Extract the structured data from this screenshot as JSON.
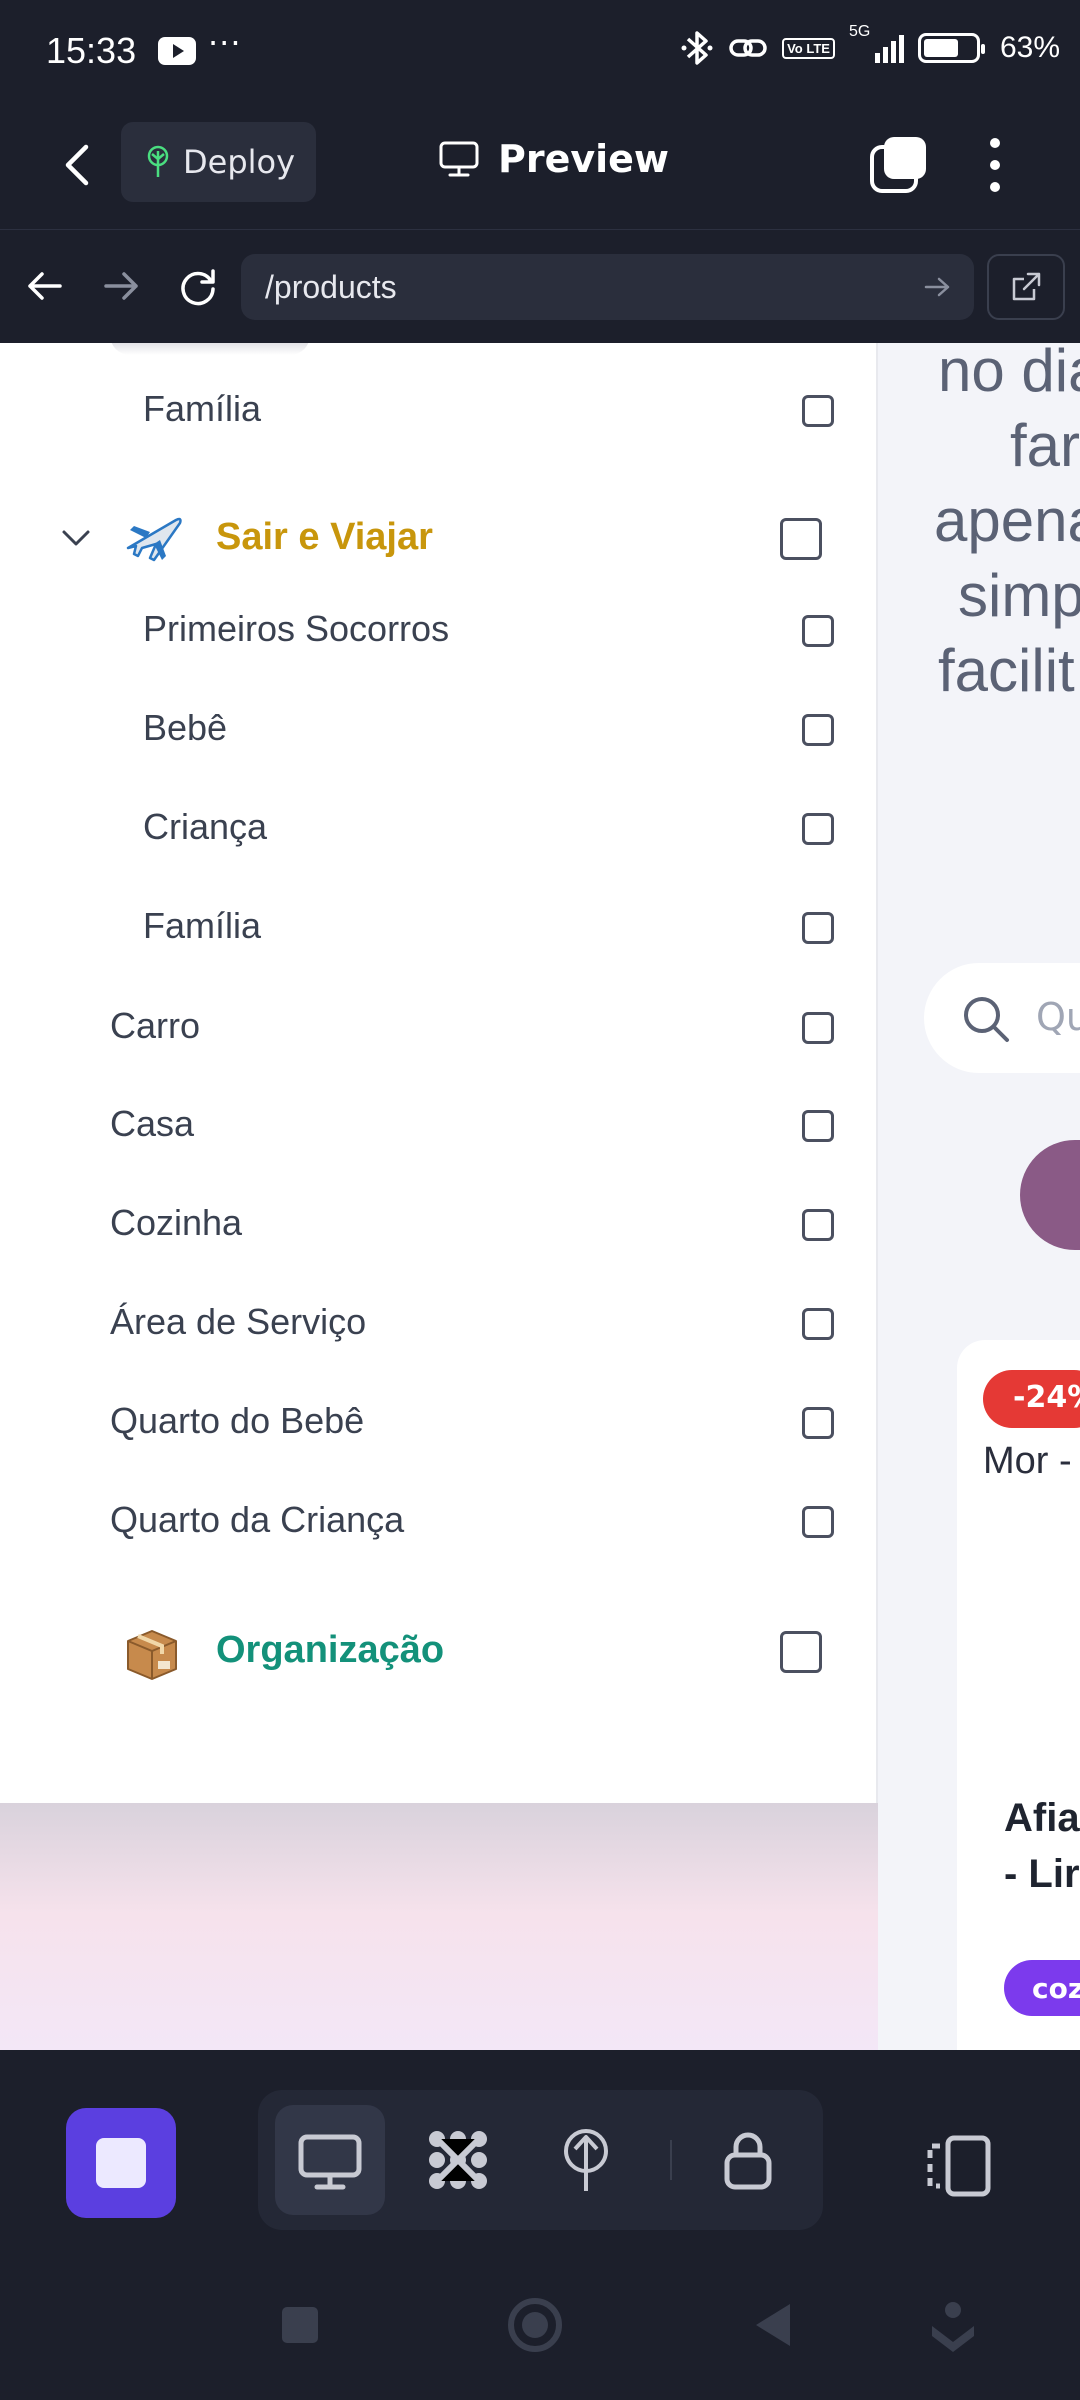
{
  "status_bar": {
    "time": "15:33",
    "dots": "···",
    "volte": "Vo LTE",
    "network": "5G",
    "battery": "63%"
  },
  "header": {
    "deploy_label": "Deploy",
    "preview_label": "Preview"
  },
  "url_bar": {
    "path": "/products"
  },
  "sidebar": {
    "rows": [
      {
        "label": "Família",
        "kind": "sub"
      },
      {
        "label": "Sair e Viajar",
        "kind": "category",
        "color": "#c8960c",
        "icon": "airplane-icon"
      },
      {
        "label": "Primeiros Socorros",
        "kind": "sub"
      },
      {
        "label": "Bebê",
        "kind": "sub"
      },
      {
        "label": "Criança",
        "kind": "sub"
      },
      {
        "label": "Família",
        "kind": "sub"
      },
      {
        "label": "Carro",
        "kind": "item"
      },
      {
        "label": "Casa",
        "kind": "item"
      },
      {
        "label": "Cozinha",
        "kind": "item"
      },
      {
        "label": "Área de Serviço",
        "kind": "item"
      },
      {
        "label": "Quarto do Bebê",
        "kind": "item"
      },
      {
        "label": "Quarto da Criança",
        "kind": "item"
      },
      {
        "label": "Organização",
        "kind": "category",
        "color": "#13917a",
        "icon": "package-icon"
      }
    ]
  },
  "page": {
    "hero_lines": [
      "no dia",
      "far",
      "apena",
      "simp",
      "facilit"
    ],
    "search_placeholder": "Qu",
    "product": {
      "discount": "-24%",
      "title": "Mor -",
      "name_line1": "Afia",
      "name_line2": "- Lir",
      "tag": "coz"
    }
  },
  "colors": {
    "accent": "#5b3fe0",
    "discount": "#e53935",
    "tag": "#7c3aed"
  }
}
